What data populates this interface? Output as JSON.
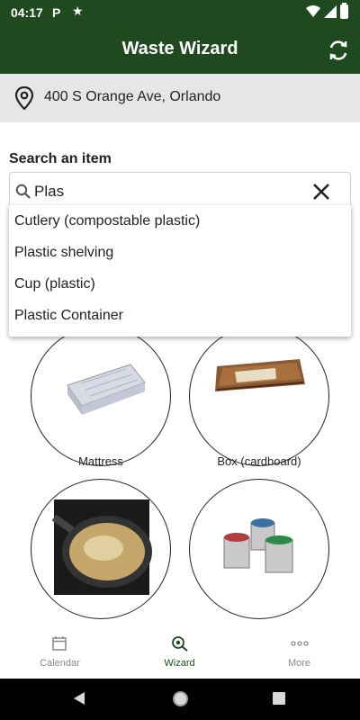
{
  "status_bar": {
    "time": "04:17",
    "notification_icon_p": "P",
    "notification_icon_star": "★"
  },
  "app_bar": {
    "title": "Waste Wizard",
    "refresh_icon": "refresh-icon"
  },
  "address": {
    "text": "400 S Orange Ave, Orlando",
    "icon": "location-pin-icon"
  },
  "search": {
    "label": "Search an item",
    "value": "Plas",
    "suggestions": [
      "Cutlery (compostable plastic)",
      "Plastic shelving",
      "Cup (plastic)",
      "Plastic Container"
    ]
  },
  "items": [
    {
      "label": "Mattress"
    },
    {
      "label": "Box (cardboard)"
    },
    {
      "label": ""
    },
    {
      "label": ""
    }
  ],
  "bottom_nav": {
    "items": [
      {
        "label": "Calendar",
        "icon": "calendar-icon"
      },
      {
        "label": "Wizard",
        "icon": "wizard-icon",
        "active": true
      },
      {
        "label": "More",
        "icon": "more-icon"
      }
    ]
  },
  "colors": {
    "primary": "#1f4a1f",
    "nav_inactive": "#888888"
  }
}
